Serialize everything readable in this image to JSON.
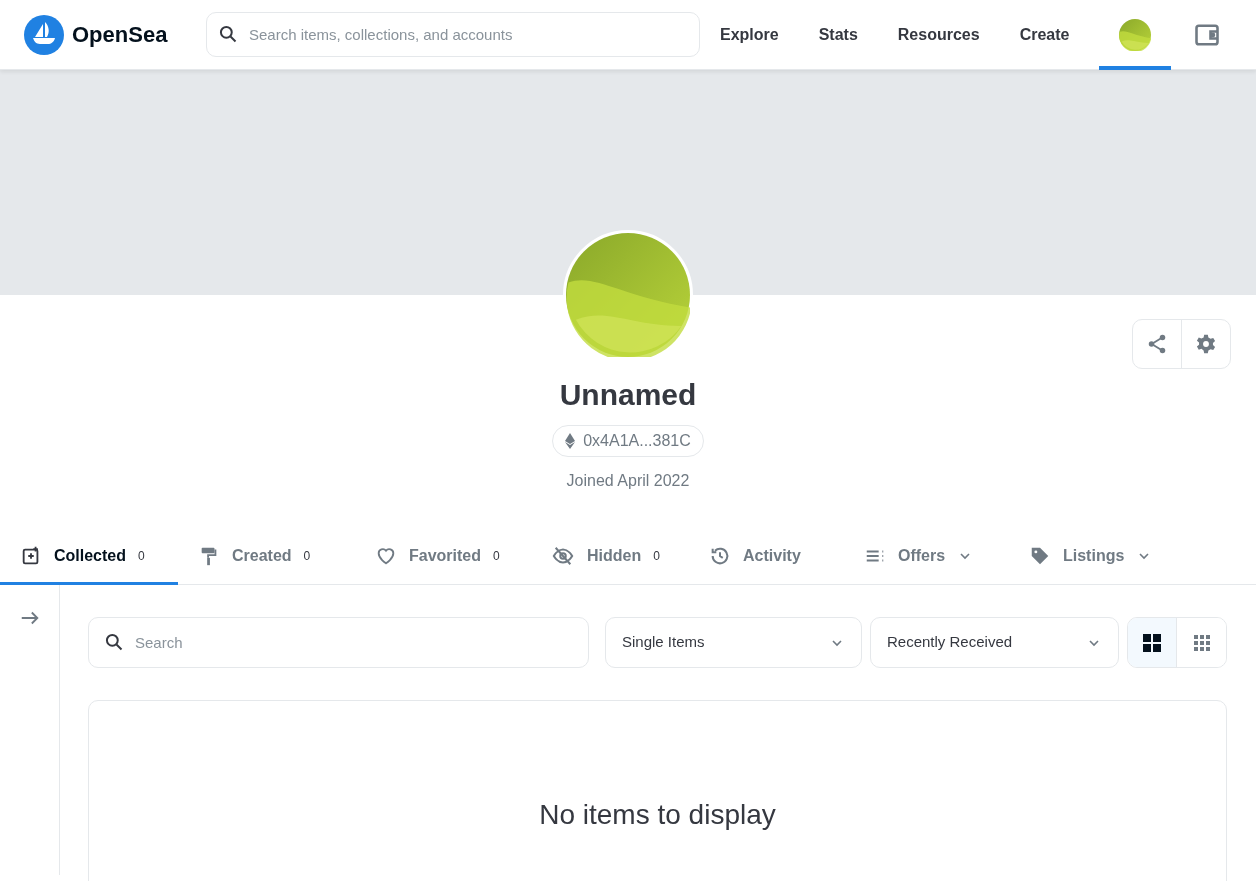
{
  "header": {
    "logo_text": "OpenSea",
    "search": {
      "placeholder": "Search items, collections, and accounts"
    },
    "nav": [
      {
        "label": "Explore",
        "selected": false
      },
      {
        "label": "Stats",
        "selected": false
      },
      {
        "label": "Resources",
        "selected": false
      },
      {
        "label": "Create",
        "selected": false
      }
    ],
    "profile_selected": true
  },
  "profile": {
    "name": "Unnamed",
    "address": "0x4A1A...381C",
    "joined": "Joined April 2022"
  },
  "tabs": [
    {
      "kind": "collected",
      "label": "Collected",
      "count": "0",
      "selected": true,
      "dropdown": false
    },
    {
      "kind": "created",
      "label": "Created",
      "count": "0",
      "selected": false,
      "dropdown": false
    },
    {
      "kind": "favorited",
      "label": "Favorited",
      "count": "0",
      "selected": false,
      "dropdown": false
    },
    {
      "kind": "hidden",
      "label": "Hidden",
      "count": "0",
      "selected": false,
      "dropdown": false
    },
    {
      "kind": "activity",
      "label": "Activity",
      "selected": false,
      "dropdown": false
    },
    {
      "kind": "offers",
      "label": "Offers",
      "selected": false,
      "dropdown": true
    },
    {
      "kind": "listings",
      "label": "Listings",
      "selected": false,
      "dropdown": true
    }
  ],
  "filters": {
    "search": {
      "placeholder": "Search"
    },
    "item_type": "Single Items",
    "sort": "Recently Received",
    "views": [
      {
        "kind": "large",
        "selected": true
      },
      {
        "kind": "small",
        "selected": false
      }
    ]
  },
  "empty_message": "No items to display"
}
